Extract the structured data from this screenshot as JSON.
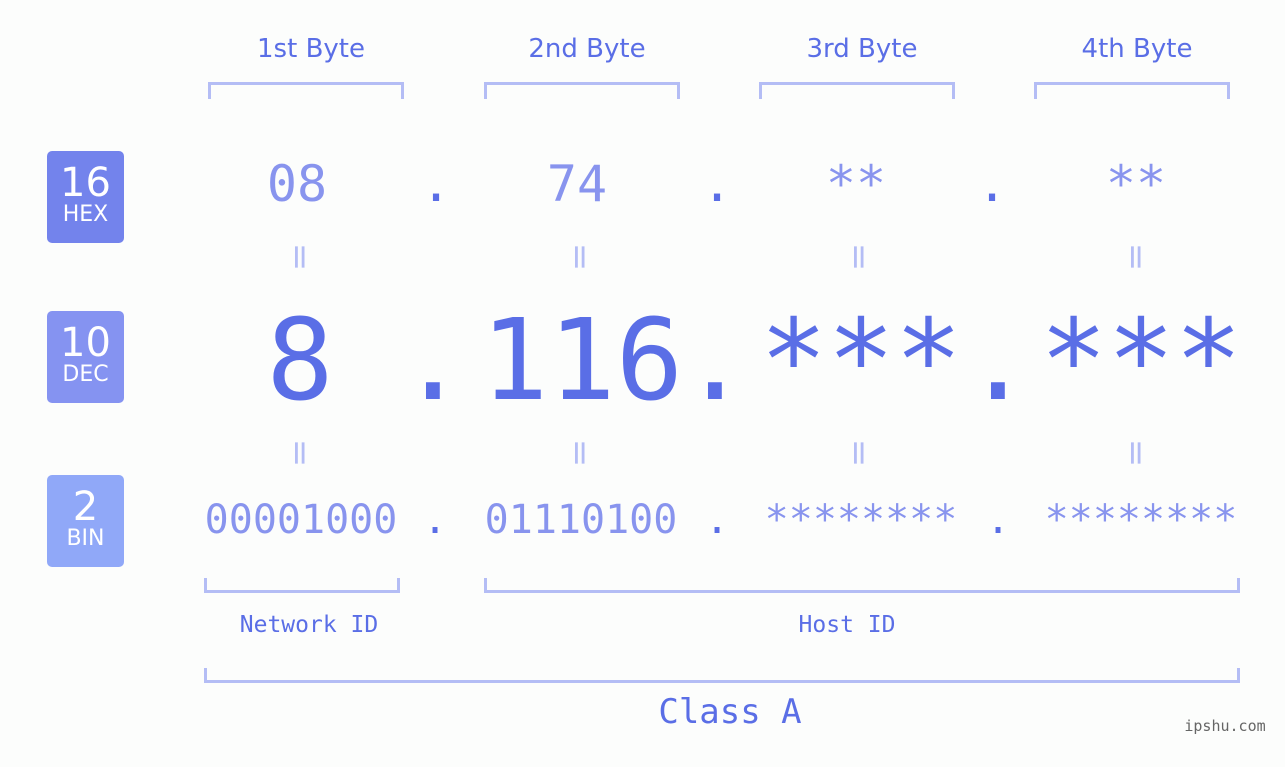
{
  "headers": [
    "1st Byte",
    "2nd Byte",
    "3rd Byte",
    "4th Byte"
  ],
  "badges": [
    {
      "num": "16",
      "label": "HEX",
      "color": "#7383ec"
    },
    {
      "num": "10",
      "label": "DEC",
      "color": "#8593f1"
    },
    {
      "num": "2",
      "label": "BIN",
      "color": "#90a8f8"
    }
  ],
  "hex": [
    "08",
    "74",
    "**",
    "**"
  ],
  "dec": [
    "8",
    "116",
    "***",
    "***"
  ],
  "bin": [
    "00001000",
    "01110100",
    "********",
    "********"
  ],
  "separator": ".",
  "equals": "=",
  "network_label": "Network ID",
  "host_label": "Host ID",
  "class_label": "Class A",
  "watermark": "ipshu.com"
}
